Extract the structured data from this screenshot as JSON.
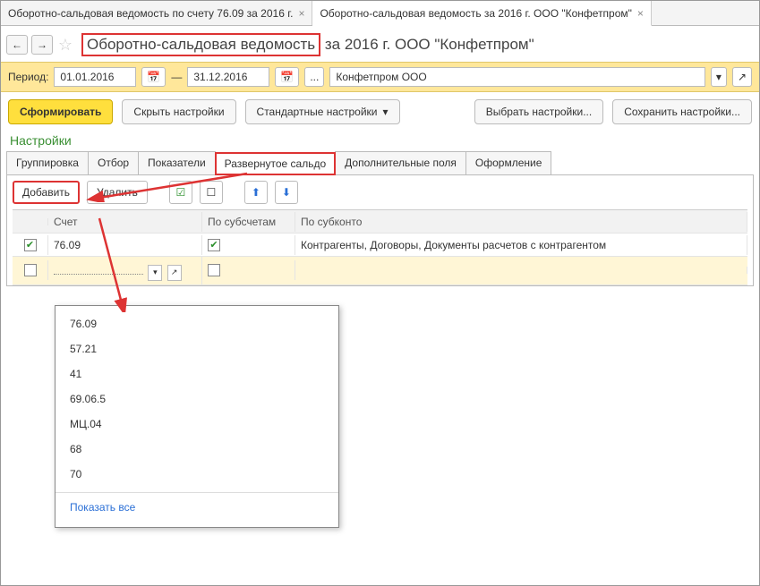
{
  "topTabs": {
    "t0": "Оборотно-сальдовая ведомость по счету 76.09 за 2016 г.",
    "t1": "Оборотно-сальдовая ведомость за 2016 г. ООО \"Конфетпром\""
  },
  "title": {
    "part1": "Оборотно-сальдовая ведомость",
    "part2": " за 2016 г. ООО \"Конфетпром\""
  },
  "period": {
    "label": "Период:",
    "from": "01.01.2016",
    "dash": "—",
    "to": "31.12.2016",
    "ellipsis": "...",
    "org": "Конфетпром ООО"
  },
  "buttons": {
    "form": "Сформировать",
    "hideSettings": "Скрыть настройки",
    "stdSettings": "Стандартные настройки",
    "chooseSettings": "Выбрать настройки...",
    "saveSettings": "Сохранить настройки..."
  },
  "settingsTitle": "Настройки",
  "stabs": {
    "group": "Группировка",
    "filter": "Отбор",
    "indic": "Показатели",
    "expanded": "Развернутое сальдо",
    "addl": "Дополнительные поля",
    "design": "Оформление"
  },
  "toolbar": {
    "add": "Добавить",
    "del": "Удалить"
  },
  "grid": {
    "hAccount": "Счет",
    "hSub": "По субсчетам",
    "hSubk": "По субконто",
    "r1acc": "76.09",
    "r1subk": "Контрагенты, Договоры, Документы расчетов с контрагентом"
  },
  "dropdown": {
    "i0": "76.09",
    "i1": "57.21",
    "i2": "41",
    "i3": "69.06.5",
    "i4": "МЦ.04",
    "i5": "68",
    "i6": "70",
    "all": "Показать все"
  }
}
